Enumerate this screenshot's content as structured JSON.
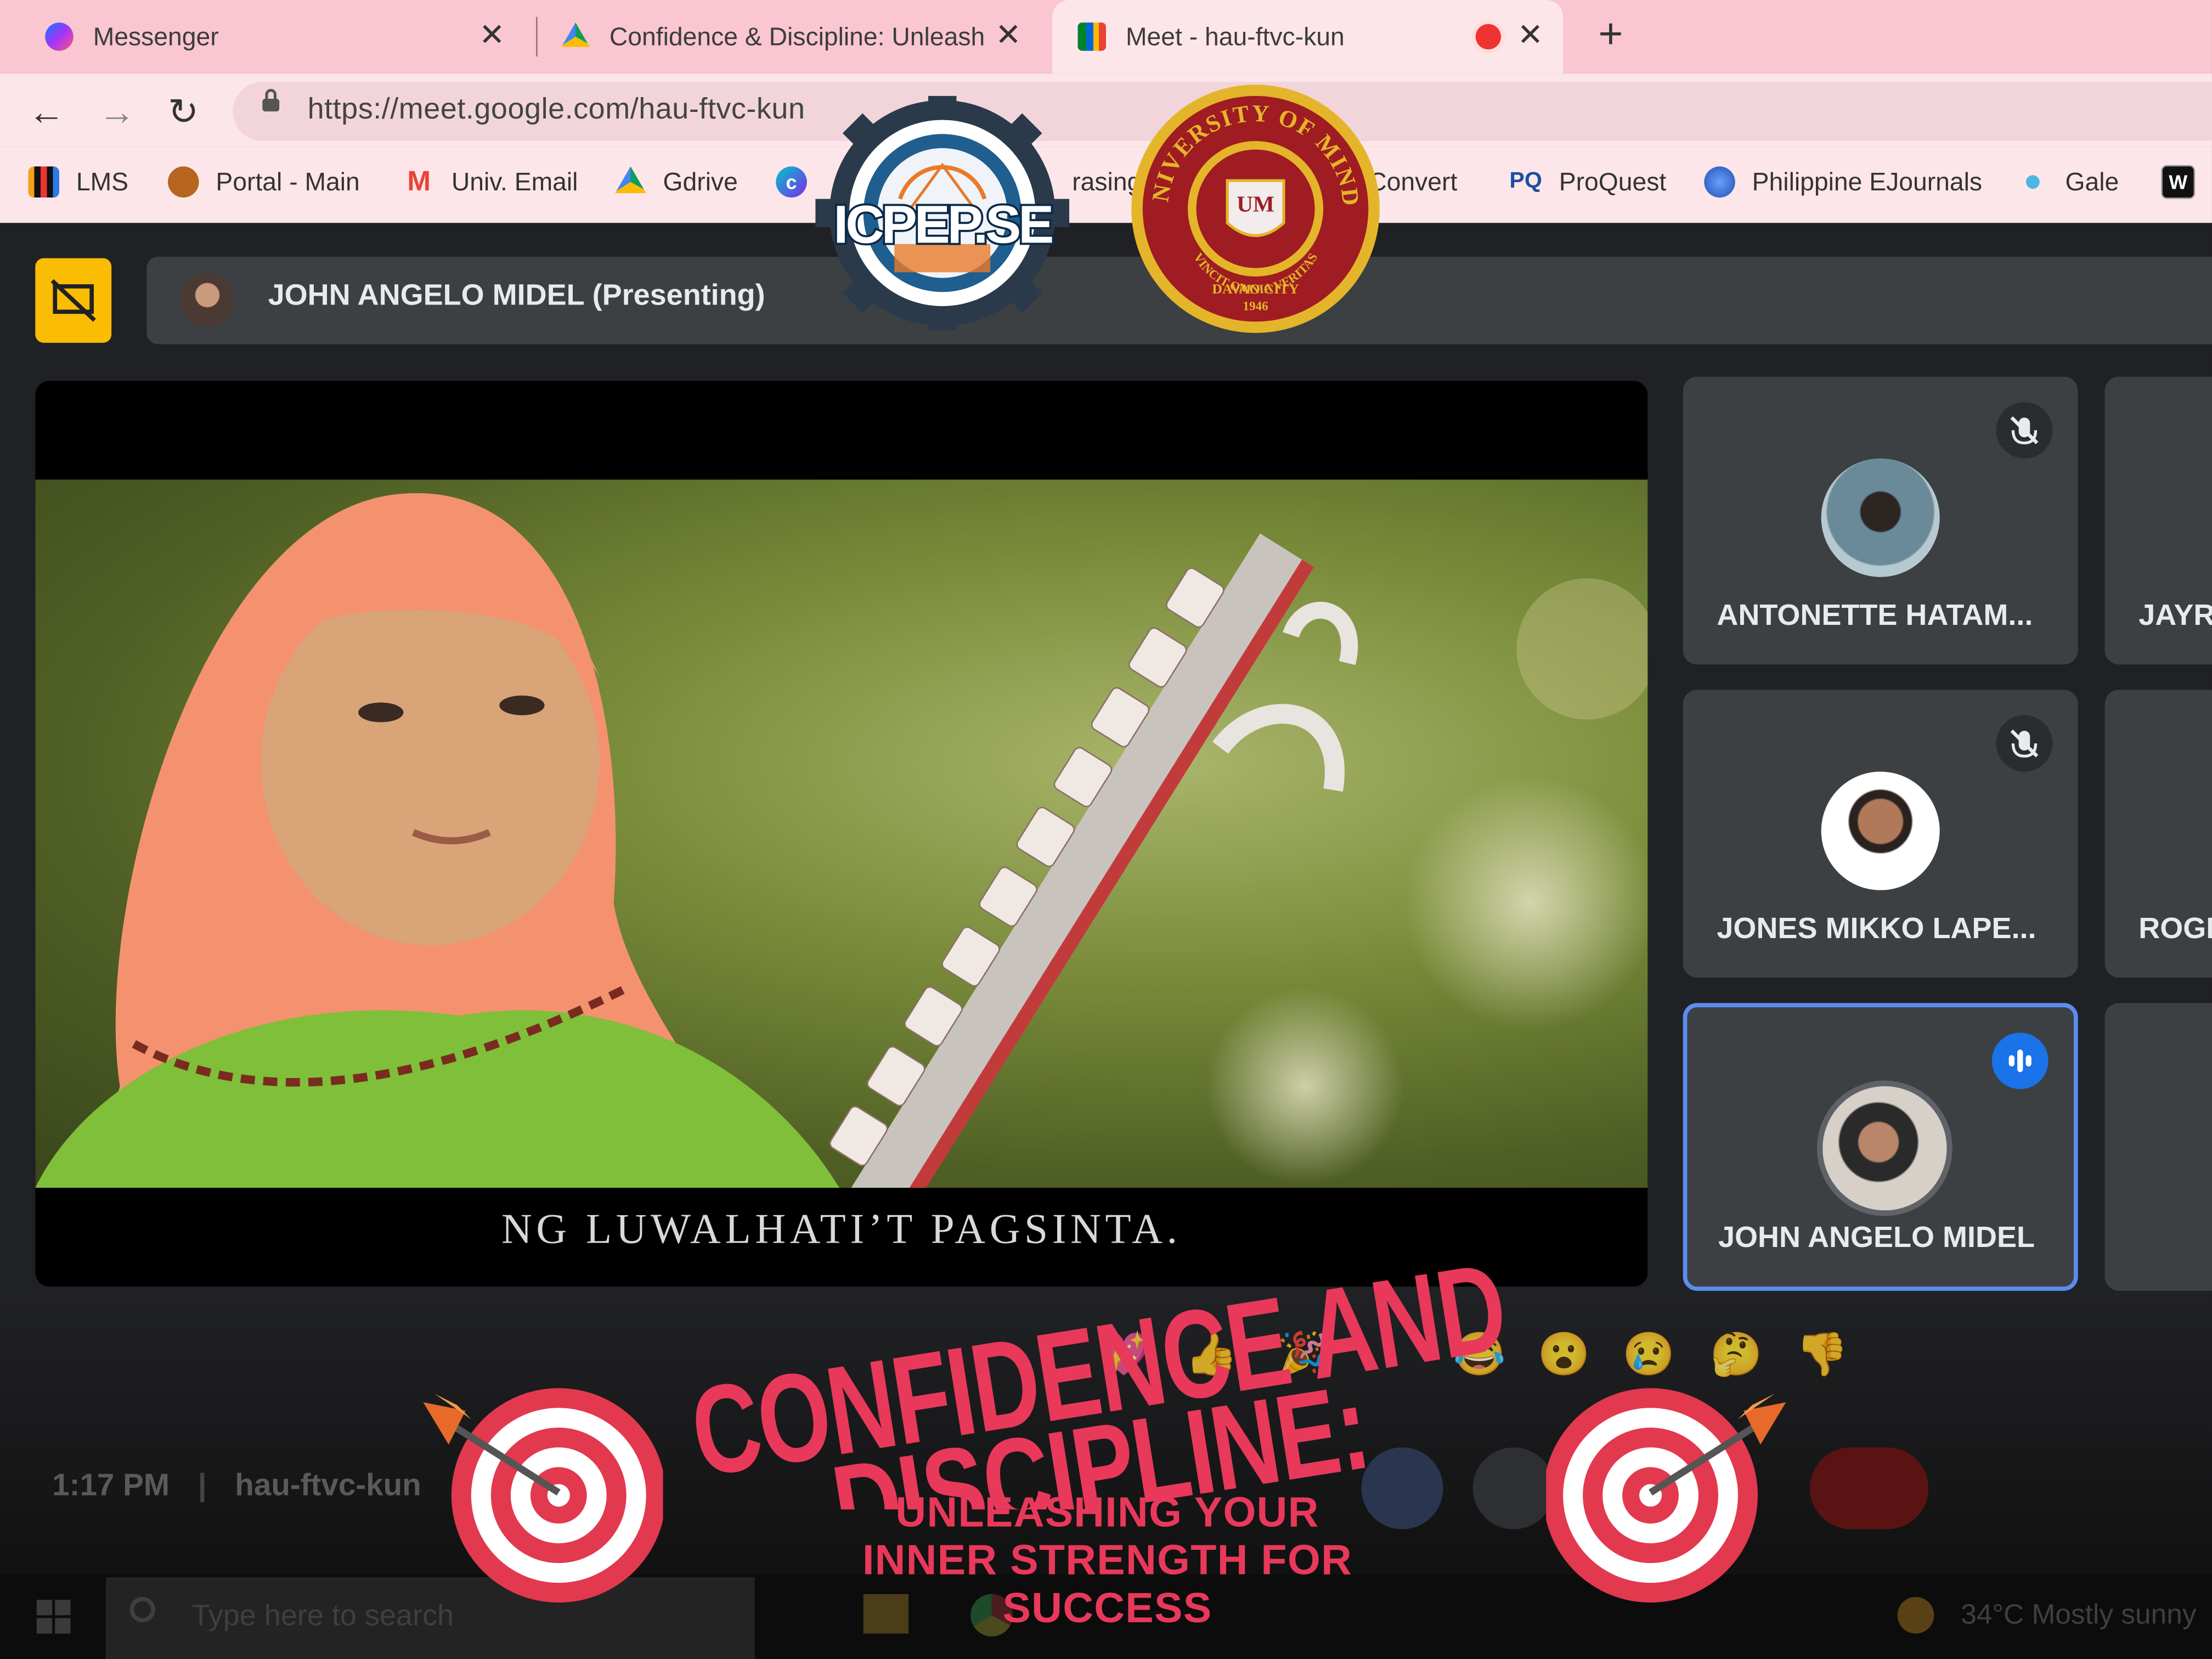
{
  "browser": {
    "tabs": [
      {
        "label": "Messenger",
        "close": "✕"
      },
      {
        "label": "Confidence & Discipline: Unleash",
        "close": "✕"
      },
      {
        "label": "Meet - hau-ftvc-kun",
        "close": "✕"
      }
    ],
    "new_tab": "+",
    "url": "https://meet.google.com/hau-ftvc-kun",
    "bookmarks": [
      {
        "label": "LMS",
        "icon": "bar-chart-icon"
      },
      {
        "label": "Portal - Main",
        "icon": "seal-icon"
      },
      {
        "label": "Univ. Email",
        "icon": "gmail-icon"
      },
      {
        "label": "Gdrive",
        "icon": "drive-icon"
      },
      {
        "label": "",
        "icon": "canva-icon"
      },
      {
        "label": "rasing",
        "icon": ""
      },
      {
        "label": "Convert",
        "icon": ""
      },
      {
        "label": "ProQuest",
        "icon": "PQ"
      },
      {
        "label": "Philippine EJournals",
        "icon": "globe-icon"
      },
      {
        "label": "Gale",
        "icon": "gale-icon"
      },
      {
        "label": "",
        "icon": "W"
      }
    ]
  },
  "meet": {
    "presenter_bar": "JOHN ANGELO MIDEL (Presenting)",
    "subtitle": "NG LUWALHATI’T PAGSINTA.",
    "participants": [
      {
        "name": "ANTONETTE HATAM...",
        "muted": true
      },
      {
        "name": "JAYR",
        "muted": false
      },
      {
        "name": "JONES MIKKO LAPE...",
        "muted": true
      },
      {
        "name": "ROGI",
        "muted": false
      },
      {
        "name": "JOHN ANGELO MIDEL",
        "speaking": true
      }
    ],
    "time": "1:17 PM",
    "meeting_code": "hau-ftvc-kun",
    "reactions": [
      "💖",
      "👍",
      "🎉",
      "😂",
      "😮",
      "😢",
      "🤔",
      "👎"
    ]
  },
  "taskbar": {
    "search_placeholder": "Type here to search",
    "weather": "34°C  Mostly sunny"
  },
  "banner": {
    "title_line1": "CONFIDENCE AND",
    "title_line2": "DISCIPLINE:",
    "subtitle": [
      "UNLEASHING YOUR",
      "INNER STRENGTH FOR",
      "SUCCESS"
    ]
  },
  "logos": {
    "icpep": "ICPEP.SE",
    "um": {
      "top": "THE UNIVERSITY OF MINDANAO",
      "motto": "VINCIT OMNIA VERITAS",
      "city": "DAVAO CITY",
      "year": "1946",
      "monogram": "UM"
    }
  },
  "colors": {
    "accent": "#e8395a",
    "tab_bar": "#f9c6d1",
    "meet_bg": "#202124",
    "speaking": "#1a73e8",
    "present": "#fbbc04"
  }
}
